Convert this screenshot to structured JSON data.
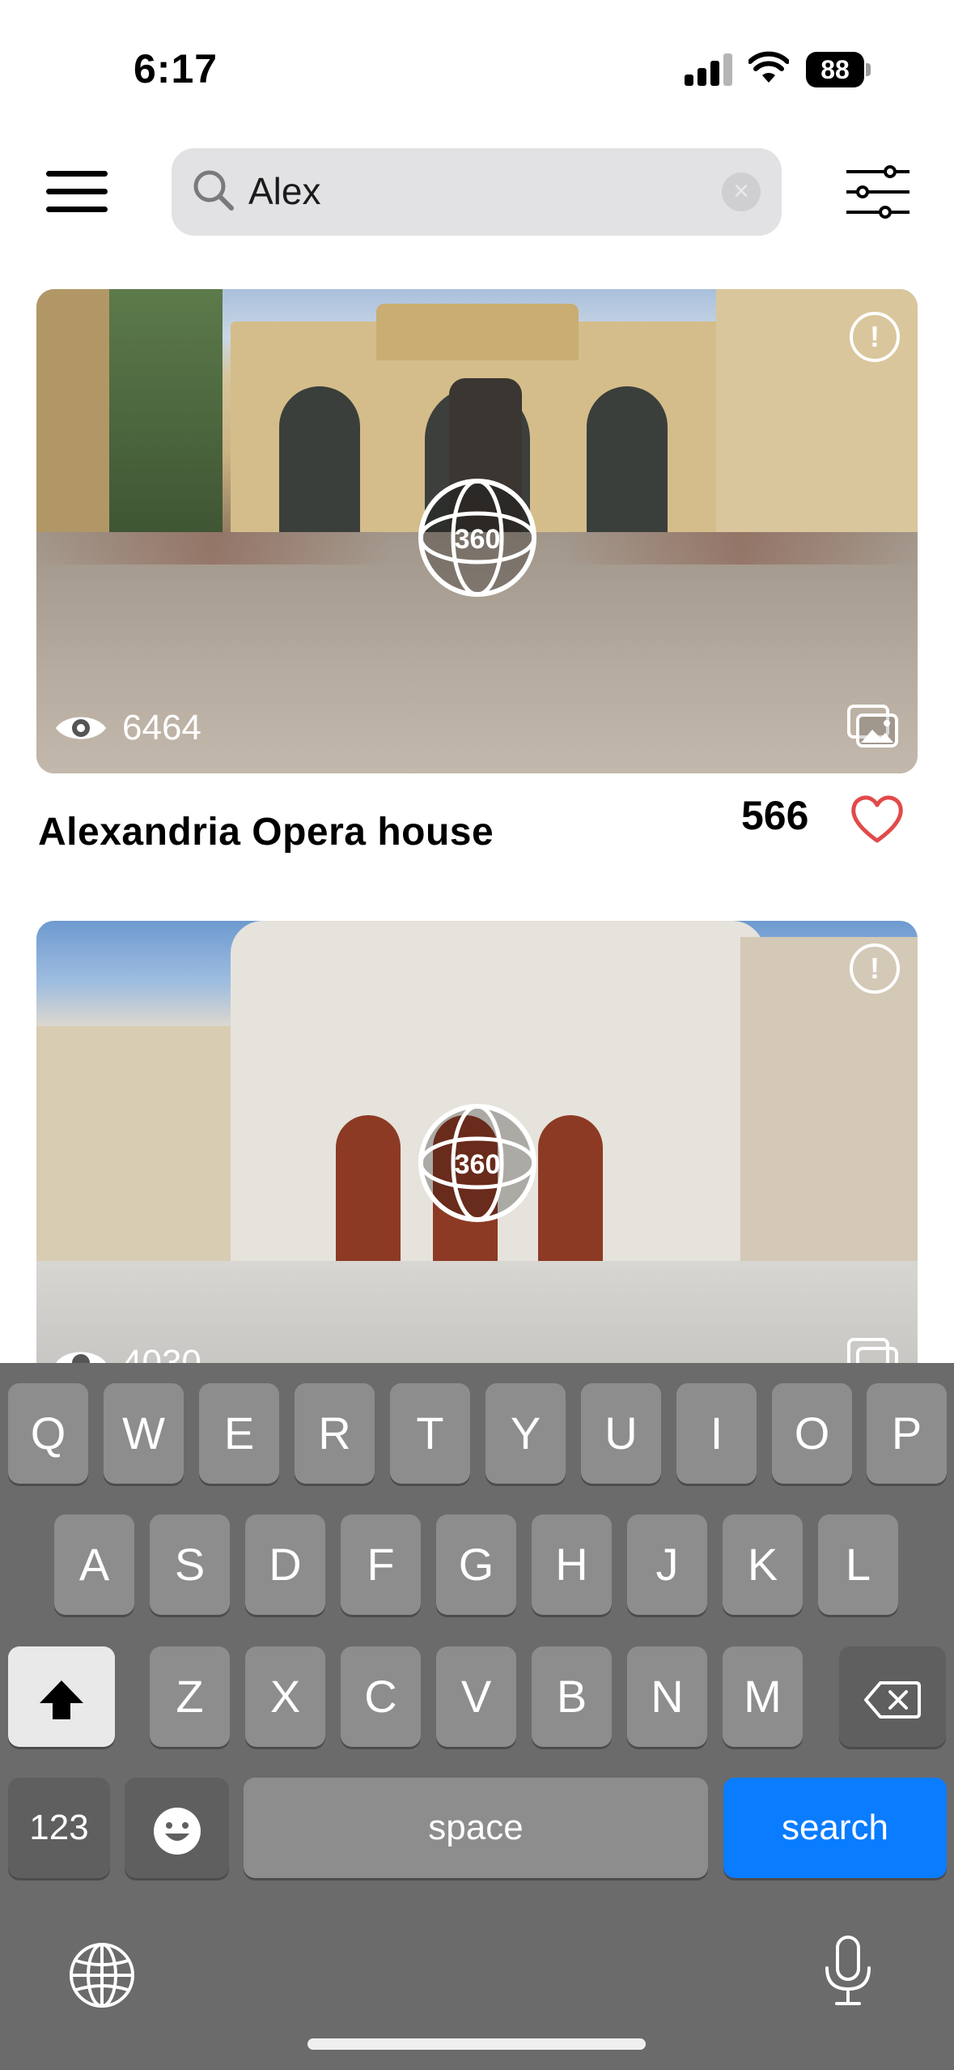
{
  "status_bar": {
    "time": "6:17",
    "battery": "88"
  },
  "search": {
    "value": "Alex"
  },
  "places": [
    {
      "title": "Alexandria Opera house",
      "views": "6464",
      "likes": "566",
      "badge": "360"
    },
    {
      "title": "",
      "views": "4030",
      "badge": "360"
    }
  ],
  "keyboard": {
    "row1": [
      "Q",
      "W",
      "E",
      "R",
      "T",
      "Y",
      "U",
      "I",
      "O",
      "P"
    ],
    "row2": [
      "A",
      "S",
      "D",
      "F",
      "G",
      "H",
      "J",
      "K",
      "L"
    ],
    "row3": [
      "Z",
      "X",
      "C",
      "V",
      "B",
      "N",
      "M"
    ],
    "numbers_label": "123",
    "space_label": "space",
    "search_label": "search"
  },
  "colors": {
    "accent": "#0a7cff",
    "heart": "#e24a4a",
    "keyboard_bg": "#6b6b6b"
  },
  "icons": [
    "menu-icon",
    "search-icon",
    "clear-icon",
    "filter-icon",
    "info-icon",
    "360-icon",
    "eye-icon",
    "gallery-icon",
    "heart-icon",
    "shift-icon",
    "backspace-icon",
    "emoji-icon",
    "globe-icon",
    "mic-icon"
  ]
}
